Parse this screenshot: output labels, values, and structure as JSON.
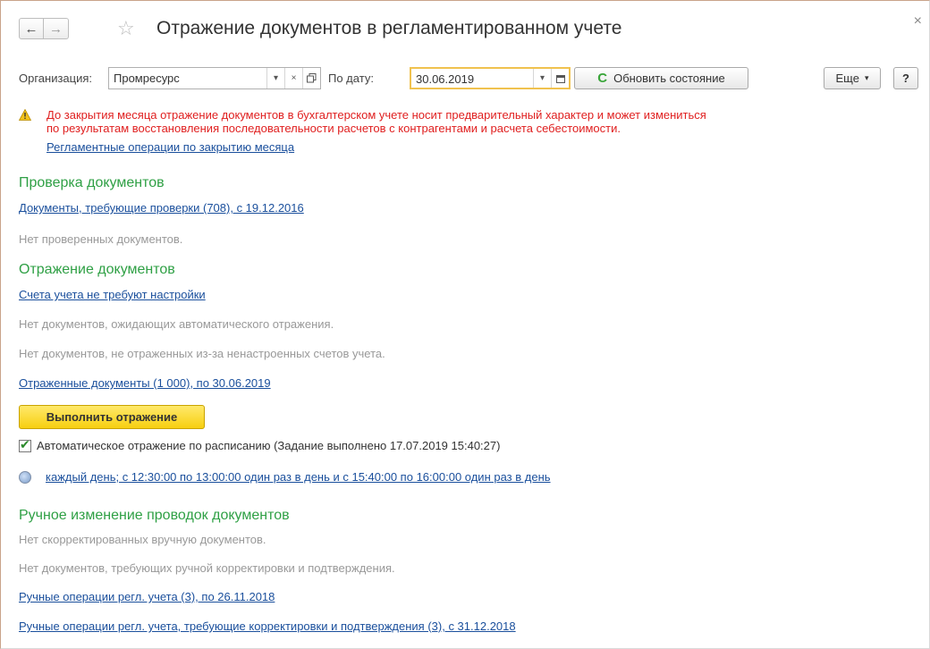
{
  "window": {
    "title": "Отражение документов в регламентированном учете",
    "close_glyph": "×"
  },
  "nav": {
    "back_glyph": "←",
    "forward_glyph": "→",
    "favorite_glyph": "☆"
  },
  "toolbar": {
    "org_label": "Организация:",
    "org_value": "Промресурс",
    "date_label": "По дату:",
    "date_value": "30.06.2019",
    "refresh_label": "Обновить состояние",
    "more_label": "Еще",
    "help_label": "?"
  },
  "warning": {
    "line1": "До закрытия месяца отражение документов в бухгалтерском учете носит предварительный характер и может измениться",
    "line2": "по результатам восстановления последовательности расчетов с контрагентами и расчета себестоимости.",
    "link": "Регламентные операции по закрытию месяца"
  },
  "check_section": {
    "heading": "Проверка документов",
    "link": "Документы, требующие проверки (708), с 19.12.2016",
    "note": "Нет проверенных документов."
  },
  "post_section": {
    "heading": "Отражение документов",
    "accounts_link": "Счета учета не требуют настройки",
    "note1": "Нет документов, ожидающих автоматического отражения.",
    "note2": "Нет документов, не отраженных из-за ненастроенных счетов учета.",
    "posted_link": "Отраженные документы (1 000), по 30.06.2019",
    "run_button": "Выполнить отражение",
    "auto_label": "Автоматическое отражение по расписанию (Задание выполнено 17.07.2019 15:40:27)",
    "schedule_link": "каждый день; с 12:30:00 по 13:00:00 один раз в день и с 15:40:00 по 16:00:00 один раз в день"
  },
  "manual_section": {
    "heading": "Ручное изменение проводок документов",
    "note1": "Нет скорректированных вручную документов.",
    "note2": "Нет документов, требующих ручной корректировки и подтверждения.",
    "link1": "Ручные операции регл. учета (3), по 26.11.2018",
    "link2": "Ручные операции регл. учета, требующие корректировки и подтверждения (3), с 31.12.2018"
  },
  "colors": {
    "section_heading": "#2fa045",
    "warning_text": "#e02020",
    "link": "#1a4f9c",
    "primary_button": "#f7cf10"
  }
}
